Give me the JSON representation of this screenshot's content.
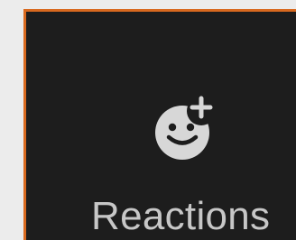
{
  "toolbar_button": {
    "label": "Reactions",
    "icon": "smiley-plus-icon"
  },
  "colors": {
    "button_background": "#1d1d1d",
    "focus_outline": "#d8691f",
    "icon_fill": "#d7d7d7",
    "label_text": "#c7c7c7",
    "page_background": "#ececec"
  }
}
